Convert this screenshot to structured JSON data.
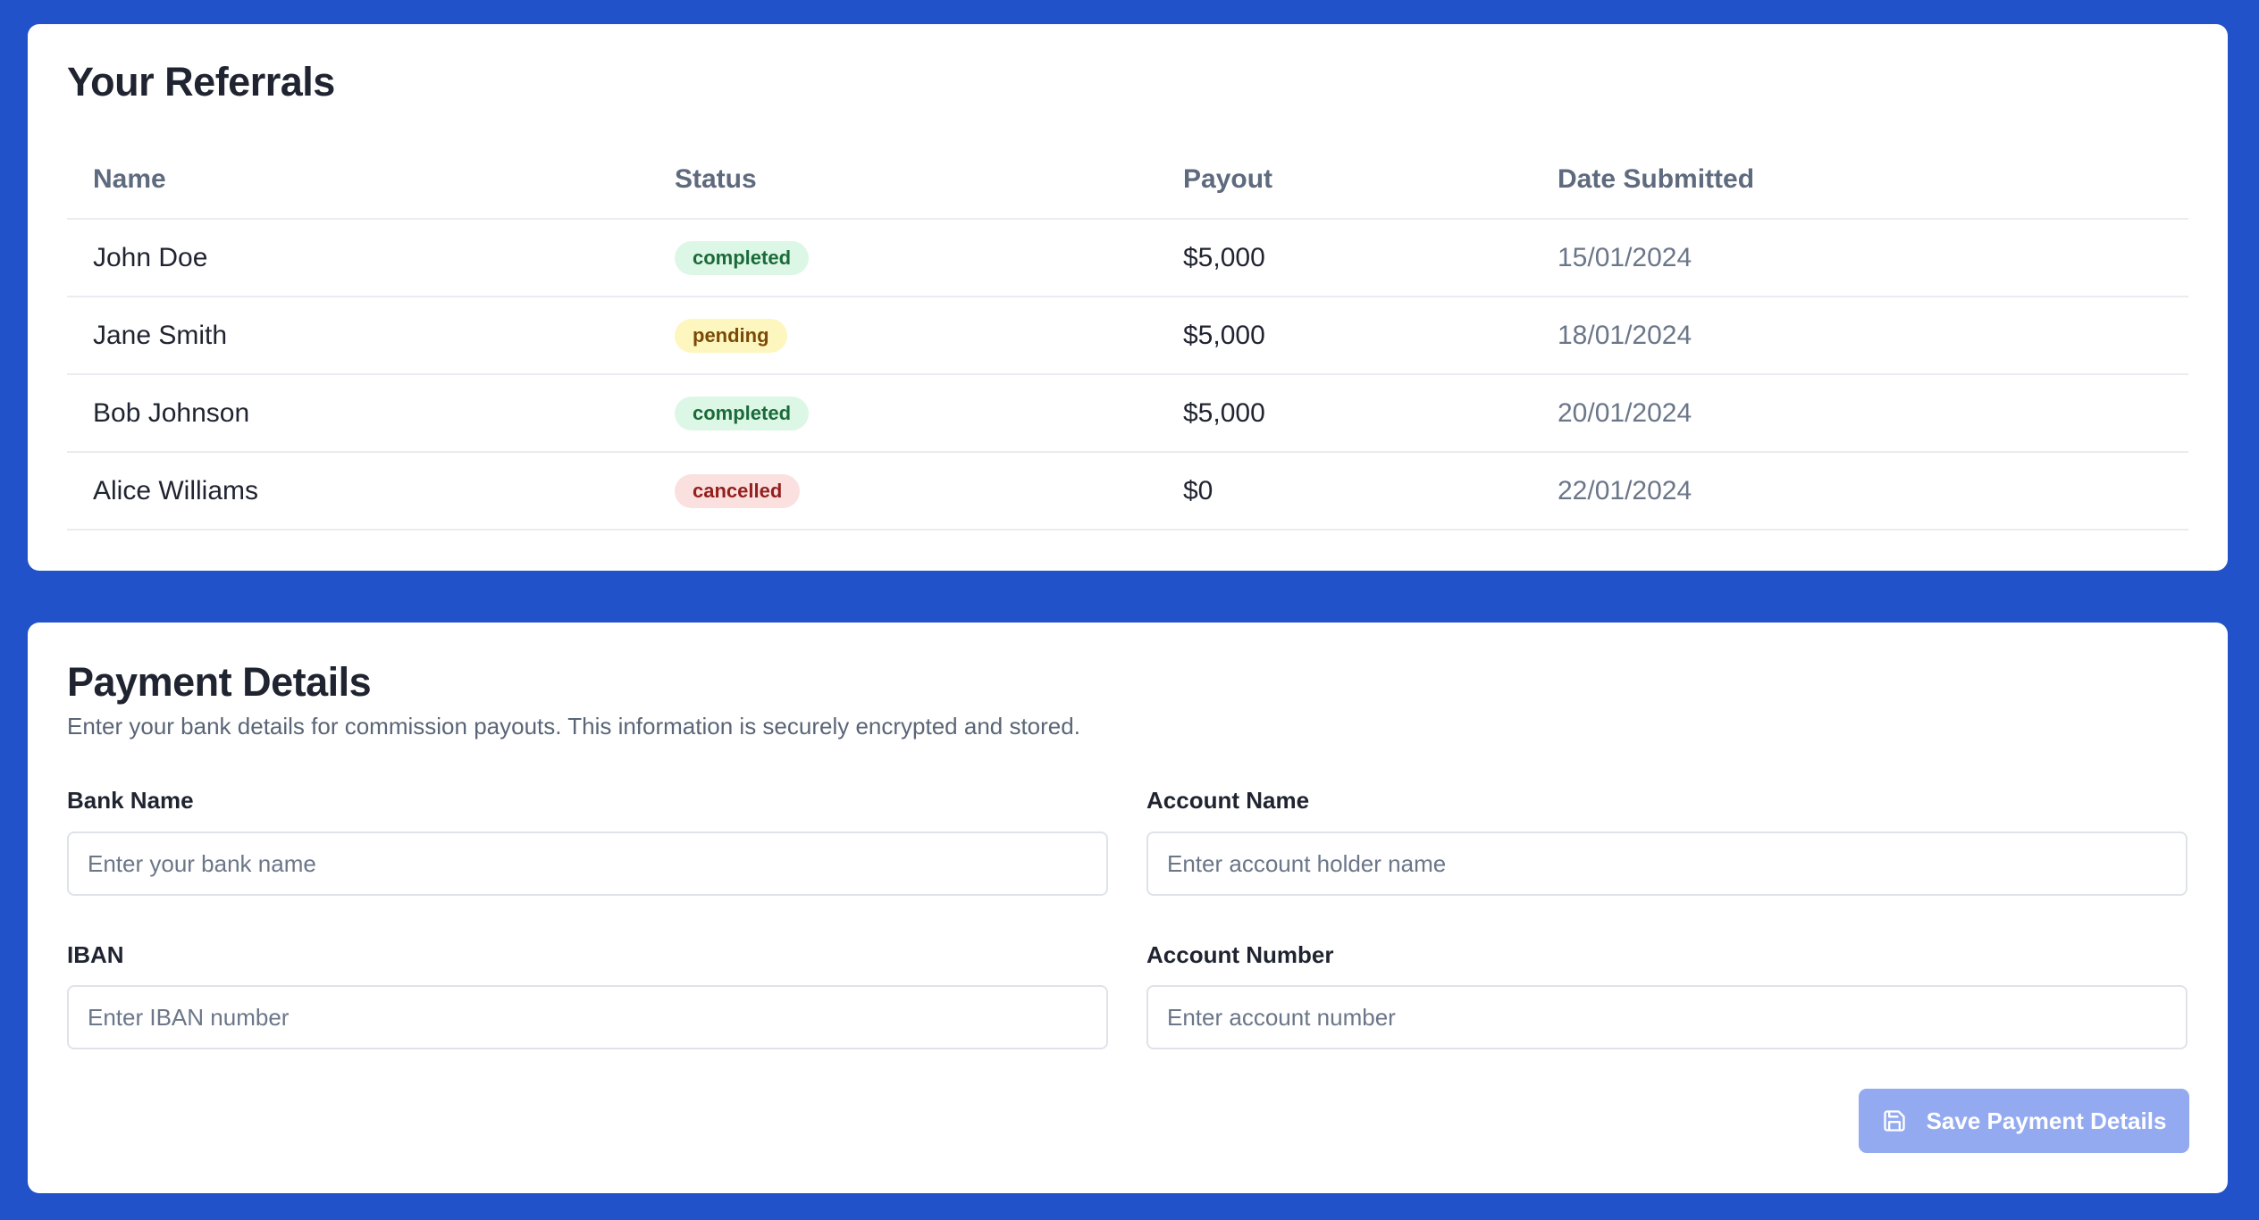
{
  "referrals": {
    "title": "Your Referrals",
    "columns": {
      "name": "Name",
      "status": "Status",
      "payout": "Payout",
      "date": "Date Submitted"
    },
    "rows": [
      {
        "name": "John Doe",
        "status": "completed",
        "payout": "$5,000",
        "date": "15/01/2024"
      },
      {
        "name": "Jane Smith",
        "status": "pending",
        "payout": "$5,000",
        "date": "18/01/2024"
      },
      {
        "name": "Bob Johnson",
        "status": "completed",
        "payout": "$5,000",
        "date": "20/01/2024"
      },
      {
        "name": "Alice Williams",
        "status": "cancelled",
        "payout": "$0",
        "date": "22/01/2024"
      }
    ]
  },
  "payment": {
    "title": "Payment Details",
    "subtitle": "Enter your bank details for commission payouts. This information is securely encrypted and stored.",
    "fields": {
      "bank_name": {
        "label": "Bank Name",
        "placeholder": "Enter your bank name",
        "value": ""
      },
      "account_name": {
        "label": "Account Name",
        "placeholder": "Enter account holder name",
        "value": ""
      },
      "iban": {
        "label": "IBAN",
        "placeholder": "Enter IBAN number",
        "value": ""
      },
      "account_number": {
        "label": "Account Number",
        "placeholder": "Enter account number",
        "value": ""
      }
    },
    "save_label": "Save Payment Details",
    "save_icon": "save-icon"
  },
  "colors": {
    "page_background": "#2152c9",
    "status_completed": "#ddf7e6",
    "status_pending": "#fdf6bf",
    "status_cancelled": "#fbe0e0",
    "save_button": "#93aaf0"
  }
}
